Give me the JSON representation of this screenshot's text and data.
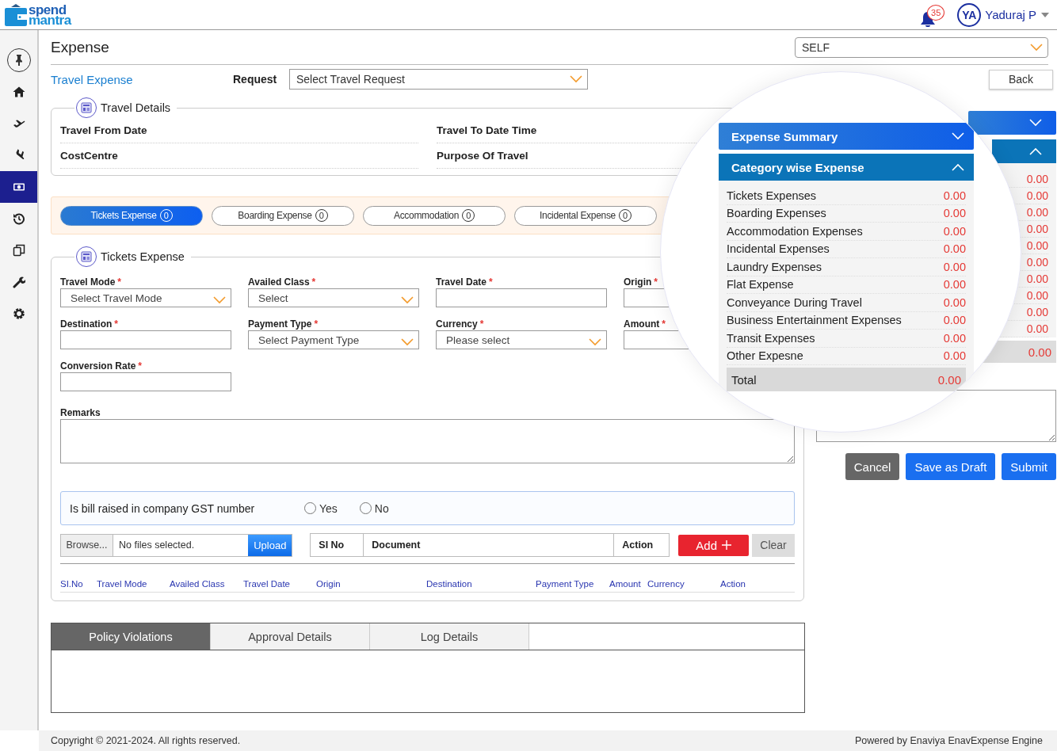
{
  "header": {
    "logo": [
      "spend",
      "mantra"
    ],
    "notifications": "35",
    "user": {
      "initials": "YA",
      "name": "Yaduraj P"
    }
  },
  "sidebar": {
    "items": [
      {
        "kind": "pin",
        "selected": false
      },
      {
        "kind": "home",
        "selected": false
      },
      {
        "kind": "departure",
        "selected": false
      },
      {
        "kind": "arrival",
        "selected": false
      },
      {
        "kind": "money",
        "selected": true
      },
      {
        "kind": "history",
        "selected": false
      },
      {
        "kind": "copy",
        "selected": false
      },
      {
        "kind": "wrench",
        "selected": false
      },
      {
        "kind": "gear",
        "selected": false
      }
    ]
  },
  "page": {
    "title": "Expense",
    "scope": "SELF"
  },
  "request_bar": {
    "section": "Travel Expense",
    "label": "Request",
    "placeholder": "Select Travel Request",
    "back": "Back"
  },
  "travel_details": {
    "title": "Travel Details",
    "fields": [
      "Travel From Date",
      "Travel To Date Time",
      "CostCentre",
      "Purpose Of Travel"
    ]
  },
  "category_tabs": [
    {
      "label": "Tickets Expense",
      "count": "0",
      "selected": true
    },
    {
      "label": "Boarding Expense",
      "count": "0",
      "selected": false
    },
    {
      "label": "Accommodation",
      "count": "0",
      "selected": false
    },
    {
      "label": "Incidental Expense",
      "count": "0",
      "selected": false
    }
  ],
  "tickets_expense": {
    "title": "Tickets Expense",
    "fields": [
      {
        "label": "Travel Mode",
        "required_mark": "*",
        "kind": "select",
        "value": "Select Travel Mode"
      },
      {
        "label": "Availed Class",
        "required_mark": "*",
        "kind": "select",
        "value": "Select"
      },
      {
        "label": "Travel Date",
        "required_mark": "*",
        "kind": "text"
      },
      {
        "label": "Origin",
        "required_mark": "*",
        "kind": "text"
      },
      {
        "label": "Destination",
        "required_mark": "*",
        "kind": "text"
      },
      {
        "label": "Payment Type",
        "required_mark": "*",
        "kind": "select",
        "value": "Select Payment Type"
      },
      {
        "label": "Currency",
        "required_mark": "*",
        "kind": "select",
        "value": "Please select"
      },
      {
        "label": "Amount",
        "required_mark": "*",
        "kind": "text"
      },
      {
        "label": "Conversion Rate",
        "required_mark": "*",
        "kind": "text"
      }
    ],
    "remarks": "Remarks"
  },
  "gst": {
    "question": "Is bill raised in company GST number",
    "options": [
      {
        "label": "Yes",
        "selected": false
      },
      {
        "label": "No",
        "selected": false
      }
    ]
  },
  "upload": {
    "browse": "Browse...",
    "file": "No files selected.",
    "button": "Upload"
  },
  "documents": {
    "columns": [
      "SI No",
      "Document",
      "Action"
    ],
    "add": "Add",
    "clear": "Clear"
  },
  "entries_table": {
    "columns": [
      "SI.No",
      "Travel Mode",
      "Availed Class",
      "Travel Date",
      "Origin",
      "Destination",
      "Payment Type",
      "Amount",
      "Currency",
      "Action"
    ]
  },
  "summary": {
    "sections": [
      {
        "expanded": false
      },
      {
        "expanded": true
      }
    ],
    "values": [
      "0.00",
      "0.00",
      "0.00",
      "0.00",
      "0.00",
      "0.00",
      "0.00",
      "0.00",
      "0.00",
      "0.00"
    ],
    "total": "0.00"
  },
  "actions": [
    {
      "label": "Cancel",
      "kind": "secondary"
    },
    {
      "label": "Save as Draft",
      "kind": "primary"
    },
    {
      "label": "Submit",
      "kind": "primary"
    }
  ],
  "bottom_tabs": [
    {
      "label": "Policy Violations",
      "selected": true
    },
    {
      "label": "Approval Details",
      "selected": false
    },
    {
      "label": "Log Details",
      "selected": false
    }
  ],
  "magnifier": {
    "sections": [
      {
        "title": "Expense Summary",
        "expanded": false
      },
      {
        "title": "Category wise Expense",
        "expanded": true
      }
    ],
    "rows": [
      {
        "label": "Tickets Expenses",
        "value": "0.00"
      },
      {
        "label": "Boarding Expenses",
        "value": "0.00"
      },
      {
        "label": "Accommodation Expenses",
        "value": "0.00"
      },
      {
        "label": "Incidental Expenses",
        "value": "0.00"
      },
      {
        "label": "Laundry Expenses",
        "value": "0.00"
      },
      {
        "label": "Flat Expense",
        "value": "0.00"
      },
      {
        "label": "Conveyance During Travel",
        "value": "0.00"
      },
      {
        "label": "Business Entertainment Expenses",
        "value": "0.00"
      },
      {
        "label": "Transit Expenses",
        "value": "0.00"
      },
      {
        "label": "Other Expesne",
        "value": "0.00"
      }
    ],
    "total": {
      "label": "Total",
      "value": "0.00"
    }
  },
  "footer": {
    "copyright": "Copyright © 2021-2024. All rights reserved.",
    "powered": "Powered by Enaviya EnavExpense Engine"
  }
}
